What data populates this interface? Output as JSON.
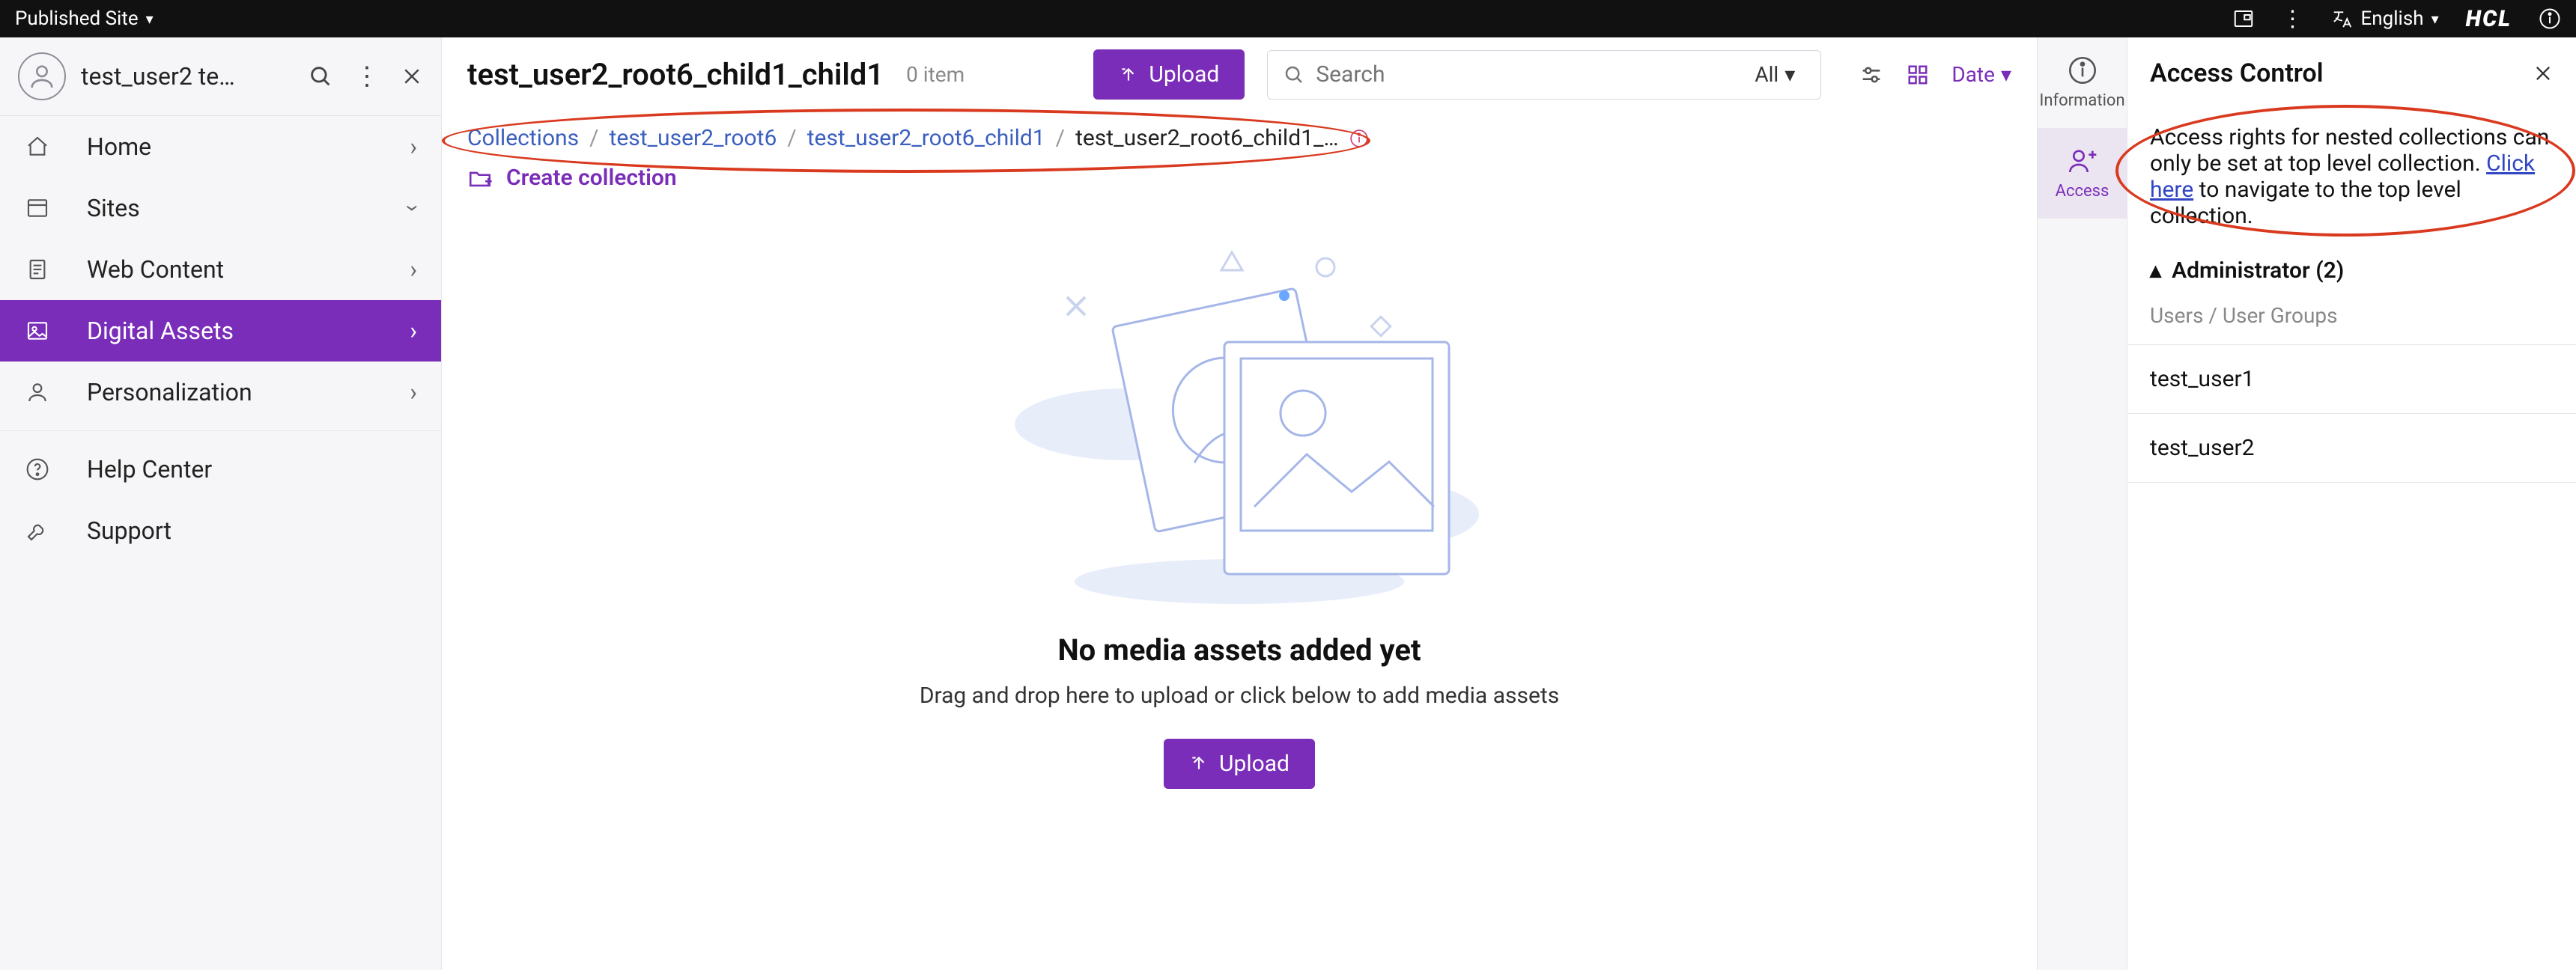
{
  "topbar": {
    "site_label": "Published Site",
    "language": "English",
    "brand": "HCL"
  },
  "sidebar": {
    "username": "test_user2 tes…",
    "nav": [
      {
        "icon": "home",
        "label": "Home",
        "chev": "right"
      },
      {
        "icon": "sites",
        "label": "Sites",
        "chev": "down"
      },
      {
        "icon": "webcontent",
        "label": "Web Content",
        "chev": "right"
      },
      {
        "icon": "digitalassets",
        "label": "Digital Assets",
        "chev": "right",
        "active": true
      },
      {
        "icon": "personalization",
        "label": "Personalization",
        "chev": "right"
      }
    ],
    "secondary": [
      {
        "icon": "help",
        "label": "Help Center"
      },
      {
        "icon": "support",
        "label": "Support"
      }
    ]
  },
  "header": {
    "title": "test_user2_root6_child1_child1",
    "item_count_label": "0 item",
    "upload_label": "Upload",
    "search_placeholder": "Search",
    "filter_label": "All",
    "sort_label": "Date"
  },
  "breadcrumb": {
    "items": [
      {
        "label": "Collections",
        "link": true
      },
      {
        "label": "test_user2_root6",
        "link": true
      },
      {
        "label": "test_user2_root6_child1",
        "link": true
      },
      {
        "label": "test_user2_root6_child1_…",
        "link": false
      }
    ]
  },
  "create_collection_label": "Create collection",
  "empty": {
    "headline": "No media assets added yet",
    "subtext": "Drag and drop here to upload or click below to add media assets",
    "upload_label": "Upload"
  },
  "rail": {
    "items": [
      {
        "key": "information",
        "label": "Information"
      },
      {
        "key": "access",
        "label": "Access",
        "active": true
      }
    ]
  },
  "panel": {
    "title": "Access Control",
    "message_pre": "Access rights for nested collections can only be set at top level collection. ",
    "message_link": "Click here",
    "message_post": " to navigate to the top level collection.",
    "section_title": "Administrator (2)",
    "section_subheader": "Users / User Groups",
    "users": [
      "test_user1",
      "test_user2"
    ]
  }
}
